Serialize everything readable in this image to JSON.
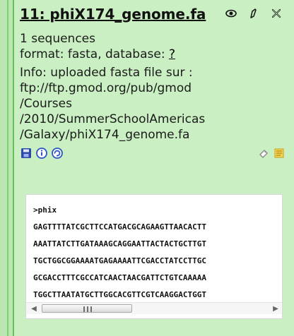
{
  "dataset": {
    "title": "11: phiX174_genome.fa",
    "meta": {
      "sequences": "1 sequences",
      "format_prefix": "format: fasta, database: ",
      "database_link": "?"
    },
    "info": {
      "line1": "Info: uploaded fasta file sur :",
      "line2": "ftp://ftp.gmod.org/pub/gmod",
      "line3": "/Courses",
      "line4": "/2010/SummerSchoolAmericas",
      "line5": "/Galaxy/phiX174_genome.fa"
    },
    "icons": {
      "title_actions": [
        "eye-icon",
        "pencil-icon",
        "delete-icon"
      ],
      "left_actions": [
        "save-icon",
        "info-icon",
        "rerun-icon"
      ],
      "right_actions": [
        "tag-icon",
        "annotation-icon"
      ]
    }
  },
  "sequence_preview": {
    "header": ">phix",
    "lines": [
      "GAGTTTTATCGCTTCCATGACGCAGAAGTTAACACTT",
      "AAATTATCTTGATAAAGCAGGAATTACTACTGCTTGT",
      "TGCTGGCGGAAAATGAGAAAATTCGACCTATCCTTGC",
      "GCGACCTTTCGCCATCAACTAACGATTCTGTCAAAAA",
      "TGGCTTAATATGCTTGGCACGTTCGTCAAGGACTGGT"
    ],
    "scroll_grip": "III"
  }
}
